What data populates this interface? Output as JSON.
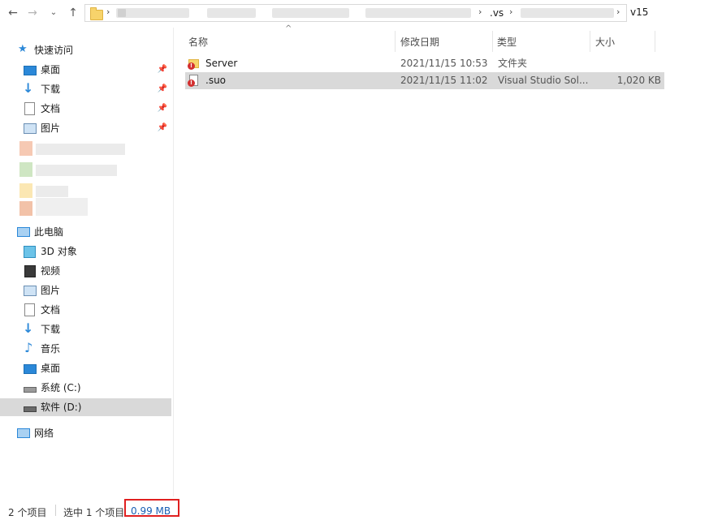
{
  "address_bar": {
    "crumbs": [
      ".vs",
      "v15"
    ]
  },
  "sidebar": {
    "quick_access": {
      "label": "快速访问",
      "items": [
        {
          "label": "桌面",
          "icon": "desktop-icon"
        },
        {
          "label": "下载",
          "icon": "download-icon"
        },
        {
          "label": "文档",
          "icon": "document-icon"
        },
        {
          "label": "图片",
          "icon": "picture-icon"
        }
      ]
    },
    "this_pc": {
      "label": "此电脑",
      "items": [
        {
          "label": "3D 对象",
          "icon": "cube-3d-icon"
        },
        {
          "label": "视频",
          "icon": "video-icon"
        },
        {
          "label": "图片",
          "icon": "picture-icon"
        },
        {
          "label": "文档",
          "icon": "document-icon"
        },
        {
          "label": "下载",
          "icon": "download-icon"
        },
        {
          "label": "音乐",
          "icon": "music-note-icon"
        },
        {
          "label": "桌面",
          "icon": "desktop-icon"
        },
        {
          "label": "系统 (C:)",
          "icon": "system-drive-icon"
        },
        {
          "label": "软件 (D:)",
          "icon": "drive-icon",
          "selected": true
        }
      ]
    },
    "network": {
      "label": "网络",
      "icon": "network-icon"
    }
  },
  "file_list": {
    "columns": [
      "名称",
      "修改日期",
      "类型",
      "大小"
    ],
    "rows": [
      {
        "name": "Server",
        "modified": "2021/11/15 10:53",
        "type": "文件夹",
        "size": "",
        "icon": "folder-with-error-icon"
      },
      {
        "name": ".suo",
        "modified": "2021/11/15 11:02",
        "type": "Visual Studio Sol...",
        "size": "1,020 KB",
        "icon": "file-with-error-icon",
        "selected": true
      }
    ]
  },
  "status_bar": {
    "item_count": "2 个项目",
    "selected": "选中 1 个项目",
    "selected_size": "0.99 MB"
  },
  "colors": {
    "selection": "#d9d9d9",
    "highlight_box": "#e02020",
    "folder": "#f7d36b",
    "pc_blue": "#2b88d8"
  }
}
